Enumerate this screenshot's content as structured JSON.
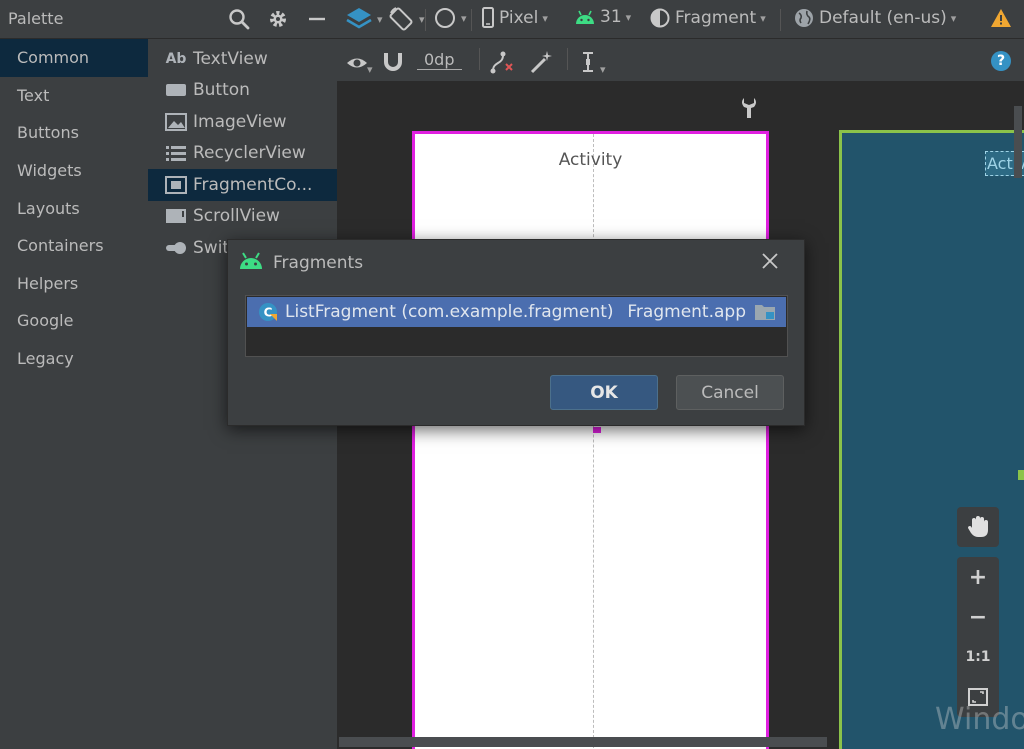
{
  "palette": {
    "title": "Palette",
    "categories": [
      "Common",
      "Text",
      "Buttons",
      "Widgets",
      "Layouts",
      "Containers",
      "Helpers",
      "Google",
      "Legacy"
    ],
    "selected_category": "Common",
    "widgets": [
      {
        "icon": "textview-icon",
        "label": "TextView"
      },
      {
        "icon": "button-icon",
        "label": "Button"
      },
      {
        "icon": "imageview-icon",
        "label": "ImageView"
      },
      {
        "icon": "recyclerview-icon",
        "label": "RecyclerView"
      },
      {
        "icon": "fragmentcontainer-icon",
        "label": "FragmentCo..."
      },
      {
        "icon": "scrollview-icon",
        "label": "ScrollView"
      },
      {
        "icon": "switch-icon",
        "label": "Swit"
      }
    ],
    "selected_widget": "FragmentCo..."
  },
  "toolbar": {
    "device": "Pixel",
    "api": "31",
    "theme": "Fragment",
    "locale": "Default (en-us)",
    "margin": "0dp"
  },
  "canvas": {
    "activity_label": "Activity",
    "blueprint_label": "Activi",
    "watermark": "Windo"
  },
  "zoom": {
    "zoom_in": "+",
    "zoom_out": "−",
    "actual_size": "1:1"
  },
  "dialog": {
    "title": "Fragments",
    "items": [
      {
        "name": "ListFragment (com.example.fragment)",
        "module": "Fragment.app"
      }
    ],
    "ok_label": "OK",
    "cancel_label": "Cancel"
  },
  "colors": {
    "background": "#2b2b2b",
    "panel": "#3c3f41",
    "selection": "#0d293e",
    "list_selection": "#4b6eaf",
    "design_border": "#e020e0",
    "blueprint": "#22546b",
    "blueprint_border": "#8bc34a",
    "android_green": "#3ddc84"
  }
}
